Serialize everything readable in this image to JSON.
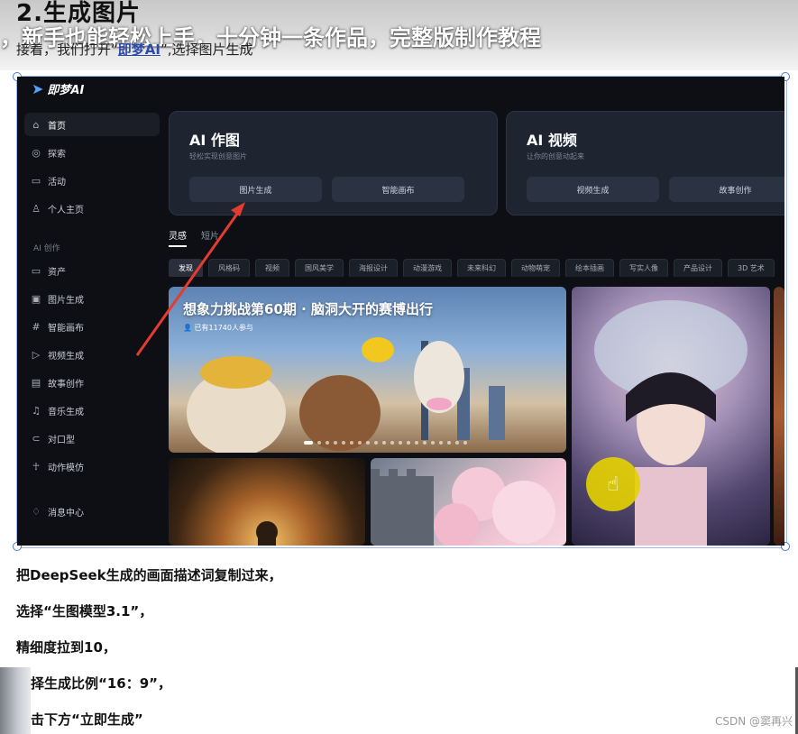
{
  "doc": {
    "heading": "2.生成图片",
    "video_title": "，新手也能轻松上手，十分钟一条作品，完整版制作教程",
    "intro_before": "接着，我们打开“",
    "intro_link": "即梦AI",
    "intro_after": "”,选择图片生成",
    "steps": [
      "把DeepSeek生成的画面描述词复制过来，",
      "选择“生图模型3.1”，",
      "精细度拉到10，",
      "择生成比例“16：9”，",
      "击下方“立即生成”"
    ],
    "watermark": "CSDN @窦再兴"
  },
  "app": {
    "logo": "即梦AI",
    "sidebar": {
      "items": [
        {
          "icon": "home-icon",
          "label": "首页"
        },
        {
          "icon": "compass-icon",
          "label": "探索"
        },
        {
          "icon": "calendar-icon",
          "label": "活动"
        },
        {
          "icon": "user-icon",
          "label": "个人主页"
        }
      ],
      "section_label": "AI 创作",
      "create_items": [
        {
          "icon": "folder-icon",
          "label": "资产"
        },
        {
          "icon": "image-icon",
          "label": "图片生成"
        },
        {
          "icon": "canvas-icon",
          "label": "智能画布"
        },
        {
          "icon": "video-icon",
          "label": "视频生成"
        },
        {
          "icon": "story-icon",
          "label": "故事创作"
        },
        {
          "icon": "music-icon",
          "label": "音乐生成"
        },
        {
          "icon": "lipsync-icon",
          "label": "对口型"
        },
        {
          "icon": "motion-icon",
          "label": "动作模仿"
        }
      ],
      "bottom_item": {
        "icon": "bell-icon",
        "label": "消息中心"
      }
    },
    "cards": [
      {
        "title": "AI 作图",
        "subtitle": "轻松实现创意图片",
        "buttons": [
          "图片生成",
          "智能画布"
        ]
      },
      {
        "title": "AI 视频",
        "subtitle": "让你的创意动起来",
        "buttons": [
          "视频生成",
          "故事创作"
        ]
      }
    ],
    "tabs": [
      "灵感",
      "短片"
    ],
    "chips": [
      "发现",
      "风格码",
      "视频",
      "国风美学",
      "海报设计",
      "动漫游戏",
      "未来科幻",
      "动物萌宠",
      "绘本插画",
      "写实人像",
      "产品设计",
      "3D 艺术"
    ],
    "hero": {
      "title": "想象力挑战第60期 · 脑洞大开的赛博出行",
      "participants": "已有11740人参与"
    }
  },
  "colors": {
    "accent_link": "#2c4aa6",
    "app_bg": "#0d0f14",
    "arrow": "#e43c2f",
    "cursor_highlight": "#e4d200"
  }
}
